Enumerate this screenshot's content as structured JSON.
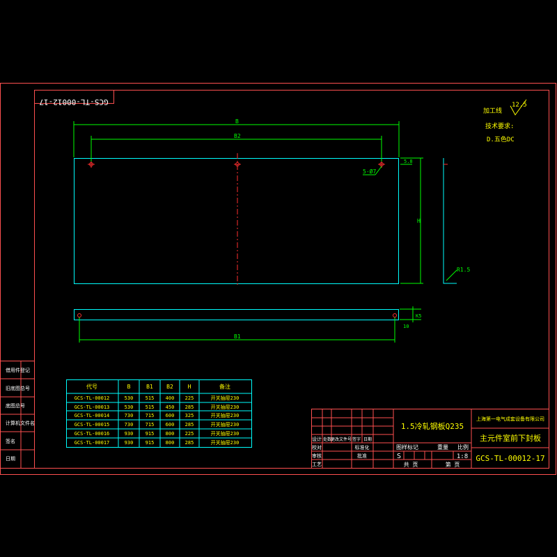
{
  "drawing_number_rotated": "GCS-TL-00012-17",
  "notes": {
    "processing_label": "加工线",
    "roughness": "12.5",
    "tech_requirements": "技术要求:",
    "tech_value": "D.五色DC"
  },
  "dimensions": {
    "B": "B",
    "B2": "B2",
    "B1": "B1",
    "H": "H",
    "holes": "5-Ø7",
    "d1": "5.8",
    "radius": "R1.5",
    "edge_offset": "K5",
    "ten": "10"
  },
  "table": {
    "headers": [
      "代号",
      "B",
      "B1",
      "B2",
      "H",
      "备注"
    ],
    "rows": [
      [
        "GCS-TL-00012",
        "530",
        "515",
        "400",
        "225",
        "开关抽屉230"
      ],
      [
        "GCS-TL-00013",
        "530",
        "515",
        "450",
        "285",
        "开关抽屉230"
      ],
      [
        "GCS-TL-00014",
        "730",
        "715",
        "600",
        "325",
        "开关抽屉230"
      ],
      [
        "GCS-TL-00015",
        "730",
        "715",
        "600",
        "285",
        "开关抽屉230"
      ],
      [
        "GCS-TL-00016",
        "930",
        "915",
        "800",
        "225",
        "开关抽屉230"
      ],
      [
        "GCS-TL-00017",
        "930",
        "915",
        "800",
        "285",
        "开关抽屉230"
      ]
    ]
  },
  "side_labels": [
    "借用件登记",
    "旧底图总号",
    "底图总号",
    "计算机文件名",
    "签名",
    "日期"
  ],
  "title_block": {
    "material": "1.5冷轧钢板Q235",
    "company": "上海第一电气成套设备有限公司",
    "part_name": "主元件室前下封板",
    "drawing_number": "GCS-TL-00012-17",
    "stage_mark": "S",
    "scale": "1:8",
    "scale_label": "比例",
    "weight_label": "重量",
    "stage_label": "图样标记",
    "total_sheets": "共 页",
    "sheet": "第 页",
    "row_labels": [
      "标记",
      "设计",
      "校对",
      "审核",
      "工艺"
    ],
    "col_labels": [
      "处数",
      "更改文件号",
      "签字",
      "日期"
    ],
    "std_label": "标准化",
    "approve_label": "批准"
  }
}
